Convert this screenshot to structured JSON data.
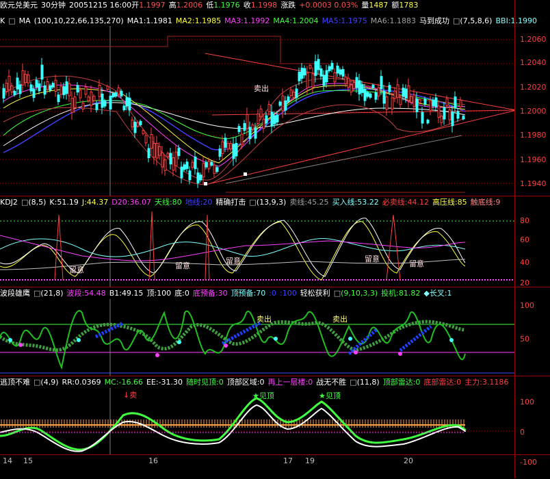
{
  "title": {
    "name": "欧元兑美元",
    "period": "30分钟",
    "datetime": "20051215 16:00",
    "open_label": "开",
    "open": "1.1997",
    "high_label": "高",
    "high": "1.2006",
    "low_label": "低",
    "low": "1.1976",
    "close_label": "收",
    "close": "1.1998",
    "change_label": "涨跌",
    "change": "+0.0003 0.03%",
    "volume_label": "量",
    "volume": "1487",
    "amount_label": "额",
    "amount": "1783"
  },
  "pane1": {
    "ind": "K",
    "toggle": "□",
    "name": "MA",
    "params": "(100,10,22,66,135,270)",
    "ma1": "MA1:1.1981",
    "ma2": "MA2:1.1985",
    "ma3": "MA3:1.1992",
    "ma4": "MA4:1.2004",
    "ma5": "MA5:1.1975",
    "ma6": "MA6:1.1883",
    "ind2": "马到成功",
    "params2": "(7,5,8,6)",
    "bbi": "BBI:1.1990",
    "yticks": [
      "1.2060",
      "1.2040",
      "1.2020",
      "1.2000",
      "1.1980",
      "1.1960",
      "1.1940"
    ],
    "sell_mark": "卖出"
  },
  "pane2": {
    "name": "KDJ2",
    "params": "(8,5)",
    "k": "K:51.19",
    "j": "J:44.37",
    "d20": "D20:36.07",
    "tianxian": "天线:80",
    "dixian": "地线:20",
    "ind2": "精确打击",
    "params2": "(13,9,3)",
    "sell": "卖线:45.25",
    "buy": "买入线:53.22",
    "must_sell": "必卖线:44.12",
    "high_press": "高压线:85",
    "touch_bottom": "触底线:9",
    "yticks": [
      "80",
      "60",
      "40",
      "20"
    ],
    "notes": [
      "留意",
      "留意",
      "留意",
      "留意",
      "留意"
    ]
  },
  "pane3": {
    "name": "波段雄鹰",
    "params": "(21,8)",
    "bd": "波段:54.48",
    "b1": "B1:49.15",
    "top": "顶:100",
    "bottom": "底:0",
    "bottom_pre": "底预备:30",
    "top_pre": "顶预备:70",
    "z0": ":0",
    "z100": ":100",
    "ind2": "轻松获利",
    "params2": "(9,10,3,3)",
    "touji": "投机:81.82",
    "changcha": "◆长叉:1",
    "yticks": [
      "100",
      "50"
    ],
    "sell1": "卖出",
    "sell2": "卖出"
  },
  "pane4": {
    "name": "逃顶不难",
    "params": "(4,9)",
    "rr": "RR:0.0369",
    "mc": "MC:-16.66",
    "ee": "EE:-31.30",
    "f1": "随时见顶:0",
    "f2": "顶部区域:0",
    "f3": "再上一层楼:0",
    "f4": "战无不胜",
    "params2": "(11,8)",
    "f5": "顶部雷达:0",
    "f6": "底部雷达:0",
    "f7": "主力:3.1186",
    "yticks": [
      "100",
      "0",
      "-100"
    ],
    "mark_sell": "↓卖",
    "mark_top1": "★见顶",
    "mark_top2": "★见顶"
  },
  "xaxis": {
    "labels": [
      "14",
      "15",
      "16",
      "17",
      "19",
      "20"
    ]
  },
  "colors": {
    "bg": "#000000",
    "grid": "#a00000",
    "axis_text": "#ff4040"
  }
}
